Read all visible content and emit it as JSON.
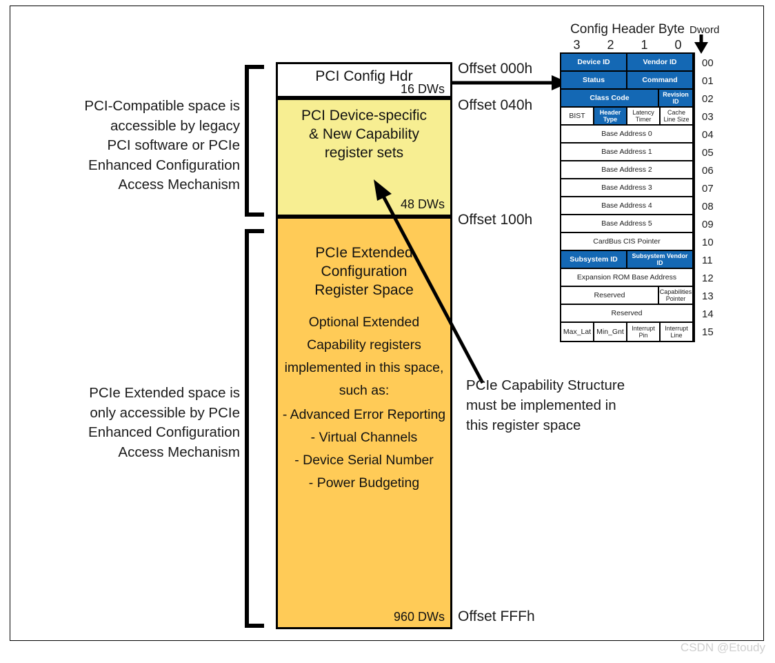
{
  "descriptions": {
    "pci_compatible": "PCI-Compatible space is\naccessible by legacy\nPCI software or PCIe\nEnhanced Configuration\nAccess Mechanism",
    "pcie_extended": "PCIe Extended space is\nonly accessible by PCIe\nEnhanced Configuration\nAccess Mechanism"
  },
  "memory_map": {
    "header_block": {
      "title": "PCI Config Hdr",
      "size": "16 DWs"
    },
    "yellow_block": {
      "title": "PCI Device-specific\n& New Capability\nregister sets",
      "size": "48 DWs"
    },
    "orange_block": {
      "title": "PCIe Extended\nConfiguration\nRegister Space",
      "body": "Optional Extended\nCapability registers\nimplemented in this space,\nsuch as:",
      "list": "- Advanced Error Reporting\n- Virtual Channels\n- Device Serial Number\n- Power Budgeting",
      "size": "960 DWs"
    }
  },
  "offsets": {
    "start": "Offset 000h",
    "device_specific": "Offset 040h",
    "extended": "Offset 100h",
    "end": "Offset FFFh"
  },
  "annotation": {
    "capability_note": "PCIe Capability Structure\nmust be implemented in\nthis register space"
  },
  "register_table": {
    "caption": "Config Header Byte",
    "dword_caption": "Dword",
    "byte_headers": [
      "3",
      "2",
      "1",
      "0"
    ],
    "rows": [
      {
        "dword": "00",
        "cells": [
          {
            "label": "Device ID",
            "span": 2,
            "blue": true
          },
          {
            "label": "Vendor ID",
            "span": 2,
            "blue": true
          }
        ]
      },
      {
        "dword": "01",
        "cells": [
          {
            "label": "Status",
            "span": 2,
            "blue": true
          },
          {
            "label": "Command",
            "span": 2,
            "blue": true
          }
        ]
      },
      {
        "dword": "02",
        "cells": [
          {
            "label": "Class Code",
            "span": 3,
            "blue": true
          },
          {
            "label": "Revision ID",
            "span": 1,
            "blue": true,
            "tall": true
          }
        ]
      },
      {
        "dword": "03",
        "cells": [
          {
            "label": "BIST",
            "span": 1,
            "blue": false
          },
          {
            "label": "Header Type",
            "span": 1,
            "blue": true,
            "tall": true
          },
          {
            "label": "Latency Timer",
            "span": 1,
            "blue": false,
            "tall": true
          },
          {
            "label": "Cache Line Size",
            "span": 1,
            "blue": false,
            "tall": true
          }
        ]
      },
      {
        "dword": "04",
        "cells": [
          {
            "label": "Base Address 0",
            "span": 4,
            "blue": false
          }
        ]
      },
      {
        "dword": "05",
        "cells": [
          {
            "label": "Base Address 1",
            "span": 4,
            "blue": false
          }
        ]
      },
      {
        "dword": "06",
        "cells": [
          {
            "label": "Base Address 2",
            "span": 4,
            "blue": false
          }
        ]
      },
      {
        "dword": "07",
        "cells": [
          {
            "label": "Base Address 3",
            "span": 4,
            "blue": false
          }
        ]
      },
      {
        "dword": "08",
        "cells": [
          {
            "label": "Base Address 4",
            "span": 4,
            "blue": false
          }
        ]
      },
      {
        "dword": "09",
        "cells": [
          {
            "label": "Base Address 5",
            "span": 4,
            "blue": false
          }
        ]
      },
      {
        "dword": "10",
        "cells": [
          {
            "label": "CardBus CIS Pointer",
            "span": 4,
            "blue": false
          }
        ]
      },
      {
        "dword": "11",
        "cells": [
          {
            "label": "Subsystem ID",
            "span": 2,
            "blue": true
          },
          {
            "label": "Subsystem Vendor ID",
            "span": 2,
            "blue": true,
            "tall": true
          }
        ]
      },
      {
        "dword": "12",
        "cells": [
          {
            "label": "Expansion ROM Base Address",
            "span": 4,
            "blue": false
          }
        ]
      },
      {
        "dword": "13",
        "cells": [
          {
            "label": "Reserved",
            "span": 3,
            "blue": false
          },
          {
            "label": "Capabilities Pointer",
            "span": 1,
            "blue": false,
            "tall": true
          }
        ]
      },
      {
        "dword": "14",
        "cells": [
          {
            "label": "Reserved",
            "span": 4,
            "blue": false
          }
        ]
      },
      {
        "dword": "15",
        "cells": [
          {
            "label": "Max_Lat",
            "span": 1,
            "blue": false
          },
          {
            "label": "Min_Gnt",
            "span": 1,
            "blue": false
          },
          {
            "label": "Interrupt Pin",
            "span": 1,
            "blue": false,
            "tall": true
          },
          {
            "label": "Interrupt Line",
            "span": 1,
            "blue": false,
            "tall": true
          }
        ]
      }
    ]
  },
  "watermark": "CSDN @Etoudy",
  "colors": {
    "blue_register": "#1468b4",
    "yellow_block": "#f7ee92",
    "orange_block": "#ffcb57"
  }
}
